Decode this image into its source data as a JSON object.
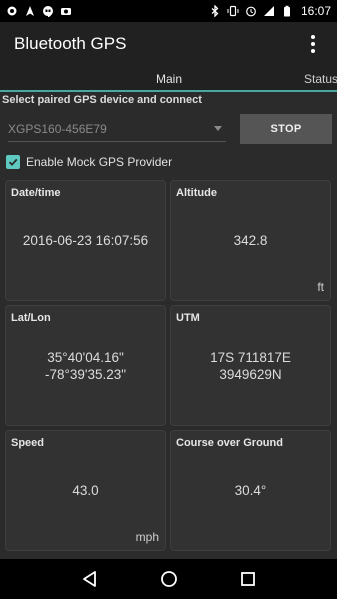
{
  "statusbar": {
    "time": "16:07",
    "left_icons": [
      "gps-icon",
      "navigation-icon",
      "hangouts-icon",
      "camera-icon"
    ],
    "right_icons": [
      "bluetooth-icon",
      "vibrate-icon",
      "alarm-icon",
      "lte-signal-icon",
      "battery-icon"
    ]
  },
  "appbar": {
    "title": "Bluetooth GPS"
  },
  "tabs": [
    {
      "label": "Main",
      "active": true
    },
    {
      "label": "Status",
      "active": false
    }
  ],
  "device": {
    "section_title": "Select paired GPS device and connect",
    "selected": "XGPS160-456E79",
    "stop_label": "STOP"
  },
  "mock": {
    "label": "Enable Mock GPS Provider",
    "checked": true
  },
  "cards": {
    "datetime": {
      "title": "Date/time",
      "value": "2016-06-23 16:07:56",
      "unit": ""
    },
    "altitude": {
      "title": "Altitude",
      "value": "342.8",
      "unit": "ft"
    },
    "latlon": {
      "title": "Lat/Lon",
      "value": "35°40'04.16\"\n-78°39'35.23\"",
      "unit": ""
    },
    "utm": {
      "title": "UTM",
      "value": "17S 711817E\n3949629N",
      "unit": ""
    },
    "speed": {
      "title": "Speed",
      "value": "43.0",
      "unit": "mph"
    },
    "course": {
      "title": "Course over Ground",
      "value": "30.4°",
      "unit": ""
    }
  },
  "colors": {
    "accent": "#5ec9c0",
    "background": "#2b2b2b",
    "appbar": "#212121"
  }
}
